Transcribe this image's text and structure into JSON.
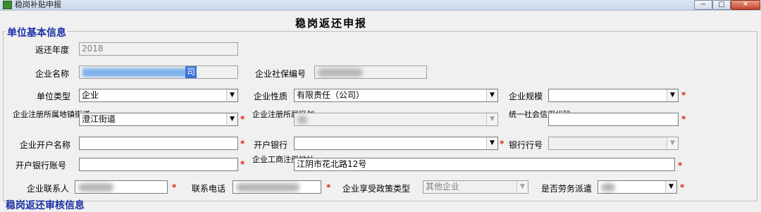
{
  "window": {
    "title": "稳岗补贴申报",
    "controls": {
      "minimize": "−",
      "maximize": "□",
      "close": "✕"
    }
  },
  "page_title": "稳岗返还申报",
  "section": {
    "legend": "单位基本信息",
    "next_legend": "稳岗返还审核信息"
  },
  "required_mark": "*",
  "dropdown_arrow": "▼",
  "fields": {
    "year": {
      "label": "返还年度",
      "value": "2018"
    },
    "company_name": {
      "label": "企业名称",
      "value": "司"
    },
    "social_security_no": {
      "label": "企业社保编号",
      "value": ""
    },
    "unit_type": {
      "label": "单位类型",
      "value": "企业"
    },
    "company_nature": {
      "label": "企业性质",
      "value": "有限责任（公司）"
    },
    "company_scale": {
      "label": "企业规模",
      "value": ""
    },
    "street": {
      "label": "企业注册所属地镇街道",
      "value": "澄江街道"
    },
    "district": {
      "label": "企业注册所属区划",
      "value": ""
    },
    "credit_code": {
      "label": "统一社会信用代码",
      "value": ""
    },
    "account_name": {
      "label": "企业开户名称",
      "value": ""
    },
    "bank": {
      "label": "开户银行",
      "value": ""
    },
    "bank_code": {
      "label": "银行行号",
      "value": ""
    },
    "account_no": {
      "label": "开户银行账号",
      "value": ""
    },
    "address": {
      "label": "企业工商注册地址",
      "value": "江阴市花北路12号"
    },
    "contact": {
      "label": "企业联系人",
      "value": ""
    },
    "phone": {
      "label": "联系电话",
      "value": ""
    },
    "policy_type": {
      "label": "企业享受政策类型",
      "value": "其他企业"
    },
    "labor_dispatch": {
      "label": "是否劳务派遣",
      "value": ""
    }
  }
}
